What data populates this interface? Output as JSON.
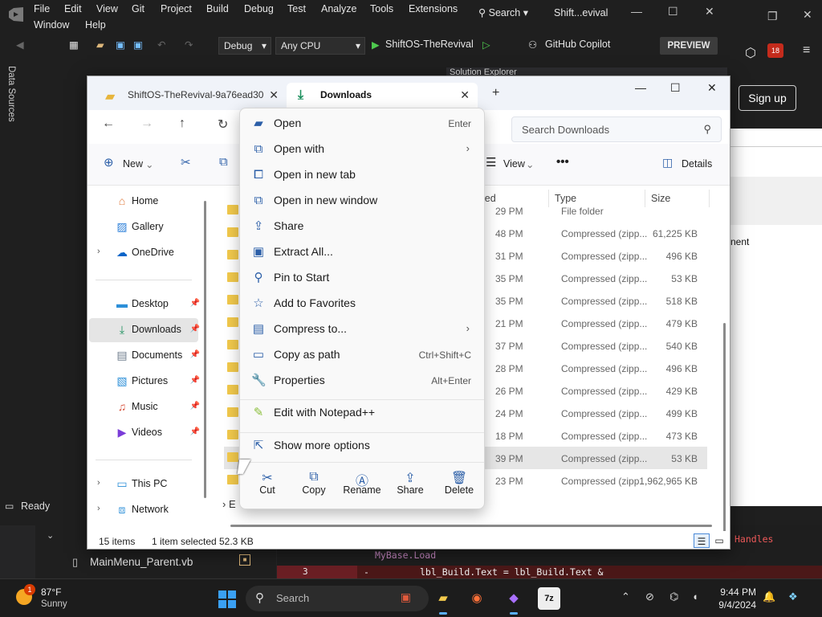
{
  "vs": {
    "menu_row1": [
      "File",
      "Edit",
      "View",
      "Git",
      "Project",
      "Build",
      "Debug",
      "Test",
      "Analyze",
      "Tools",
      "Extensions"
    ],
    "menu_row2": [
      "Window",
      "Help"
    ],
    "search_label": "Search",
    "title": "Shift...evival",
    "config": "Debug",
    "platform": "Any CPU",
    "run_target": "ShiftOS-TheRevival",
    "copilot": "GitHub Copilot",
    "preview": "PREVIEW",
    "data_sources": "Data Sources",
    "notif_count": "18",
    "sign_up": "Sign up",
    "solution_explorer": "Solution Explorer",
    "right_text": "nent",
    "status": "Ready",
    "file_tab": "MainMenu_Parent.vb",
    "code_line1": "MyBase.Load",
    "code_line2": "lbl_Build.Text = lbl_Build.Text &",
    "code_handles": "Handles",
    "diff_num": "3",
    "diff_sign": "-"
  },
  "explorer": {
    "tabs": [
      {
        "label": "ShiftOS-TheRevival-9a76ead30",
        "icon": "folder-zip-icon"
      },
      {
        "label": "Downloads",
        "icon": "download-icon"
      }
    ],
    "search_placeholder": "Search Downloads",
    "toolbar": {
      "new_label": "New",
      "view_label": "View",
      "details_label": "Details"
    },
    "sidebar": [
      {
        "label": "Home",
        "icon": "home-icon",
        "expandable": false,
        "pinned": false
      },
      {
        "label": "Gallery",
        "icon": "gallery-icon",
        "expandable": false,
        "pinned": false
      },
      {
        "label": "OneDrive",
        "icon": "cloud-icon",
        "expandable": true,
        "pinned": false
      },
      {
        "label": "Desktop",
        "icon": "desktop-icon",
        "expandable": false,
        "pinned": true
      },
      {
        "label": "Downloads",
        "icon": "download-icon",
        "expandable": false,
        "pinned": true,
        "selected": true
      },
      {
        "label": "Documents",
        "icon": "document-icon",
        "expandable": false,
        "pinned": true
      },
      {
        "label": "Pictures",
        "icon": "pictures-icon",
        "expandable": false,
        "pinned": true
      },
      {
        "label": "Music",
        "icon": "music-icon",
        "expandable": false,
        "pinned": true
      },
      {
        "label": "Videos",
        "icon": "videos-icon",
        "expandable": false,
        "pinned": true
      },
      {
        "label": "This PC",
        "icon": "pc-icon",
        "expandable": true,
        "pinned": false
      },
      {
        "label": "Network",
        "icon": "network-icon",
        "expandable": true,
        "pinned": false
      }
    ],
    "columns": {
      "date": "ied",
      "type": "Type",
      "size": "Size"
    },
    "files": [
      {
        "date": "29 PM",
        "type": "File folder",
        "size": ""
      },
      {
        "date": "48 PM",
        "type": "Compressed (zipp...",
        "size": "61,225 KB"
      },
      {
        "date": "31 PM",
        "type": "Compressed (zipp...",
        "size": "496 KB"
      },
      {
        "date": "35 PM",
        "type": "Compressed (zipp...",
        "size": "53 KB"
      },
      {
        "date": "35 PM",
        "type": "Compressed (zipp...",
        "size": "518 KB"
      },
      {
        "date": "21 PM",
        "type": "Compressed (zipp...",
        "size": "479 KB"
      },
      {
        "date": "37 PM",
        "type": "Compressed (zipp...",
        "size": "540 KB"
      },
      {
        "date": "28 PM",
        "type": "Compressed (zipp...",
        "size": "496 KB"
      },
      {
        "date": "26 PM",
        "type": "Compressed (zipp...",
        "size": "429 KB"
      },
      {
        "date": "24 PM",
        "type": "Compressed (zipp...",
        "size": "499 KB"
      },
      {
        "date": "18 PM",
        "type": "Compressed (zipp...",
        "size": "473 KB"
      },
      {
        "date": "39 PM",
        "type": "Compressed (zipp...",
        "size": "53 KB",
        "selected": true
      },
      {
        "date": "23 PM",
        "type": "Compressed (zipp...",
        "size": "1,962,965 KB"
      }
    ],
    "group_label": "E",
    "status": {
      "items": "15 items",
      "selected": "1 item selected",
      "size": "52.3 KB"
    }
  },
  "context_menu": {
    "items": [
      {
        "label": "Open",
        "shortcut": "Enter",
        "icon": "open-icon",
        "submenu": false
      },
      {
        "label": "Open with",
        "shortcut": "",
        "icon": "open-with-icon",
        "submenu": true
      },
      {
        "label": "Open in new tab",
        "shortcut": "",
        "icon": "new-tab-icon",
        "submenu": false
      },
      {
        "label": "Open in new window",
        "shortcut": "",
        "icon": "new-window-icon",
        "submenu": false
      },
      {
        "label": "Share",
        "shortcut": "",
        "icon": "share-icon",
        "submenu": false
      },
      {
        "label": "Extract All...",
        "shortcut": "",
        "icon": "extract-icon",
        "submenu": false
      },
      {
        "label": "Pin to Start",
        "shortcut": "",
        "icon": "pin-icon",
        "submenu": false
      },
      {
        "label": "Add to Favorites",
        "shortcut": "",
        "icon": "star-icon",
        "submenu": false
      },
      {
        "label": "Compress to...",
        "shortcut": "",
        "icon": "compress-icon",
        "submenu": true
      },
      {
        "label": "Copy as path",
        "shortcut": "Ctrl+Shift+C",
        "icon": "copy-path-icon",
        "submenu": false
      },
      {
        "label": "Properties",
        "shortcut": "Alt+Enter",
        "icon": "properties-icon",
        "submenu": false
      }
    ],
    "notepad": {
      "label": "Edit with Notepad++",
      "icon": "notepad-icon"
    },
    "more": {
      "label": "Show more options",
      "icon": "more-options-icon"
    },
    "actions": [
      {
        "label": "Cut",
        "icon": "cut-icon"
      },
      {
        "label": "Copy",
        "icon": "copy-icon"
      },
      {
        "label": "Rename",
        "icon": "rename-icon"
      },
      {
        "label": "Share",
        "icon": "share-icon"
      },
      {
        "label": "Delete",
        "icon": "delete-icon"
      }
    ]
  },
  "taskbar": {
    "weather_badge": "1",
    "temperature": "87°F",
    "condition": "Sunny",
    "search_label": "Search",
    "time": "9:44 PM",
    "date": "9/4/2024"
  }
}
